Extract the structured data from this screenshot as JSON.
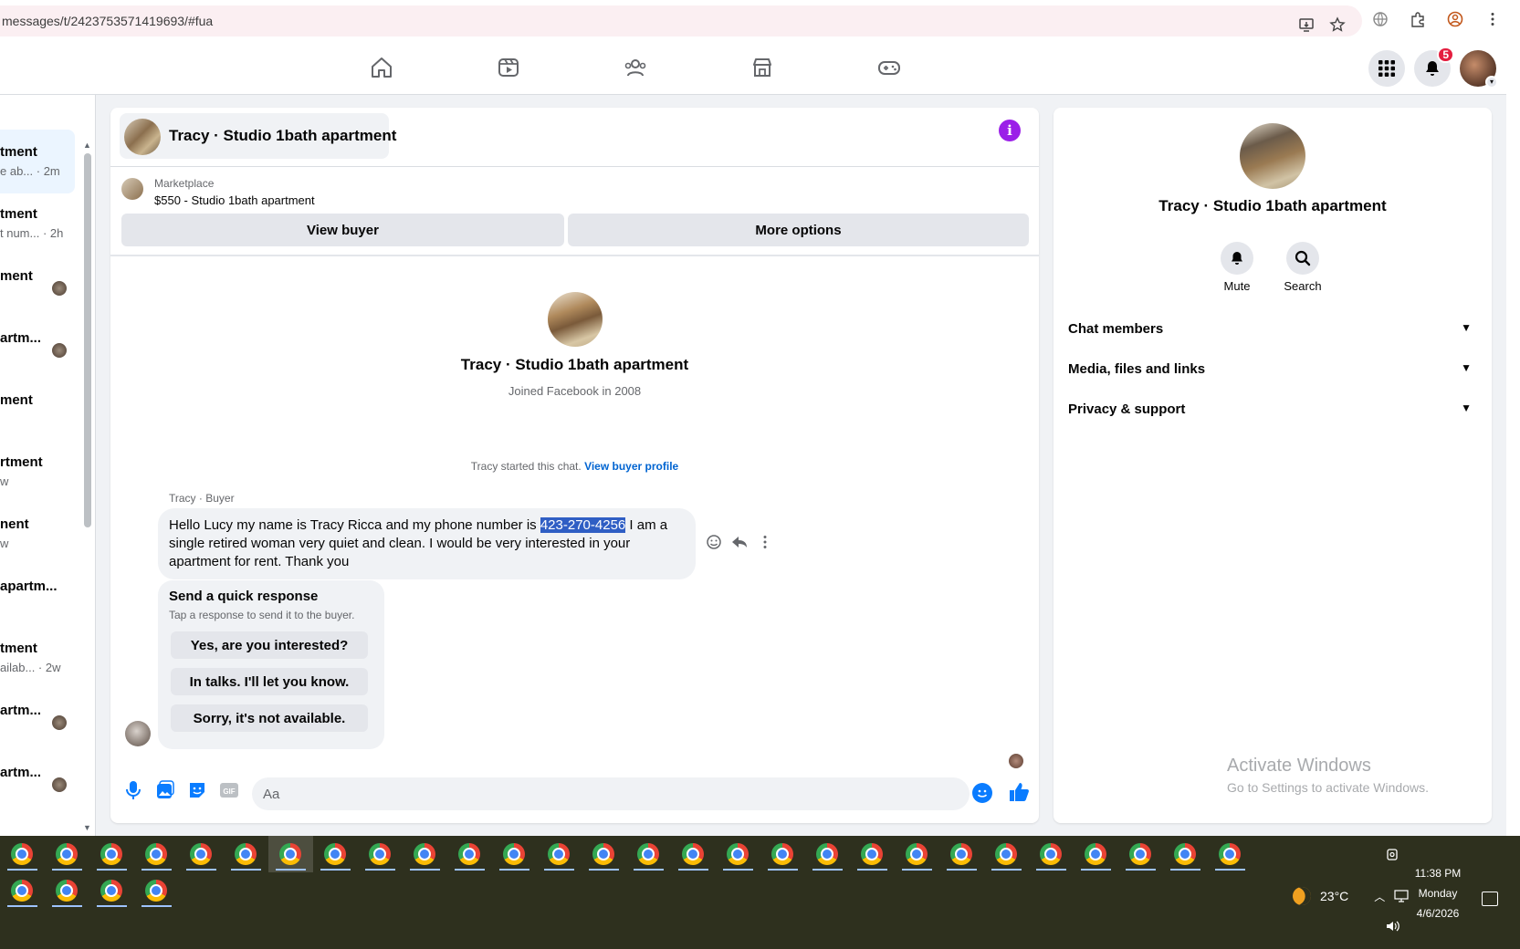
{
  "browser": {
    "url": "messages/t/2423753571419693/#fua"
  },
  "topnav": {
    "icons": [
      "home-icon",
      "watch-icon",
      "groups-icon",
      "marketplace-icon",
      "gaming-icon"
    ],
    "notification_count": "5"
  },
  "chat_list": {
    "items": [
      {
        "title": "tment",
        "sub": "e ab... · 2m",
        "active": true
      },
      {
        "title": "tment",
        "sub": "t num... · 2h"
      },
      {
        "title": "ment",
        "sub": ""
      },
      {
        "title": "artm...",
        "sub": ""
      },
      {
        "title": "ment",
        "sub": ""
      },
      {
        "title": "rtment",
        "sub": "w"
      },
      {
        "title": "nent",
        "sub": "w"
      },
      {
        "title": "apartm...",
        "sub": ""
      },
      {
        "title": "tment",
        "sub": "ailab... · 2w"
      },
      {
        "title": "artm...",
        "sub": ""
      },
      {
        "title": "artm...",
        "sub": ""
      }
    ]
  },
  "chat": {
    "header_name": "Tracy · Studio 1bath apartment",
    "marketplace_label": "Marketplace",
    "listing": "$550 - Studio 1bath apartment",
    "view_buyer": "View buyer",
    "more_options": "More options",
    "profile_name": "Tracy · Studio 1bath apartment",
    "joined": "Joined Facebook in 2008",
    "started_text": "Tracy started this chat.",
    "started_link": "View buyer profile",
    "sender": "Tracy · Buyer",
    "message_before": "Hello Lucy my name is Tracy Ricca and my phone number is ",
    "message_phone": "423-270-4256",
    "message_after": " I am a single retired woman very quiet and clean. I would be very interested in your apartment for rent. Thank you",
    "quick_title": "Send a quick response",
    "quick_sub": "Tap a response to send it to the buyer.",
    "quick_responses": [
      "Yes, are you interested?",
      "In talks. I'll let you know.",
      "Sorry, it's not available."
    ],
    "composer_placeholder": "Aa"
  },
  "details": {
    "name": "Tracy · Studio 1bath apartment",
    "mute": "Mute",
    "search": "Search",
    "sections": [
      "Chat members",
      "Media, files and links",
      "Privacy & support"
    ],
    "activate_title": "Activate Windows",
    "activate_sub": "Go to Settings to activate Windows."
  },
  "taskbar": {
    "temperature": "23°C",
    "time": "11:38 PM",
    "day": "Monday",
    "date": "4/6/2026"
  },
  "colors": {
    "accent": "#0a7cff",
    "info": "#9b1fe8",
    "badge": "#e41e3f",
    "highlight": "#2f5ec4"
  }
}
